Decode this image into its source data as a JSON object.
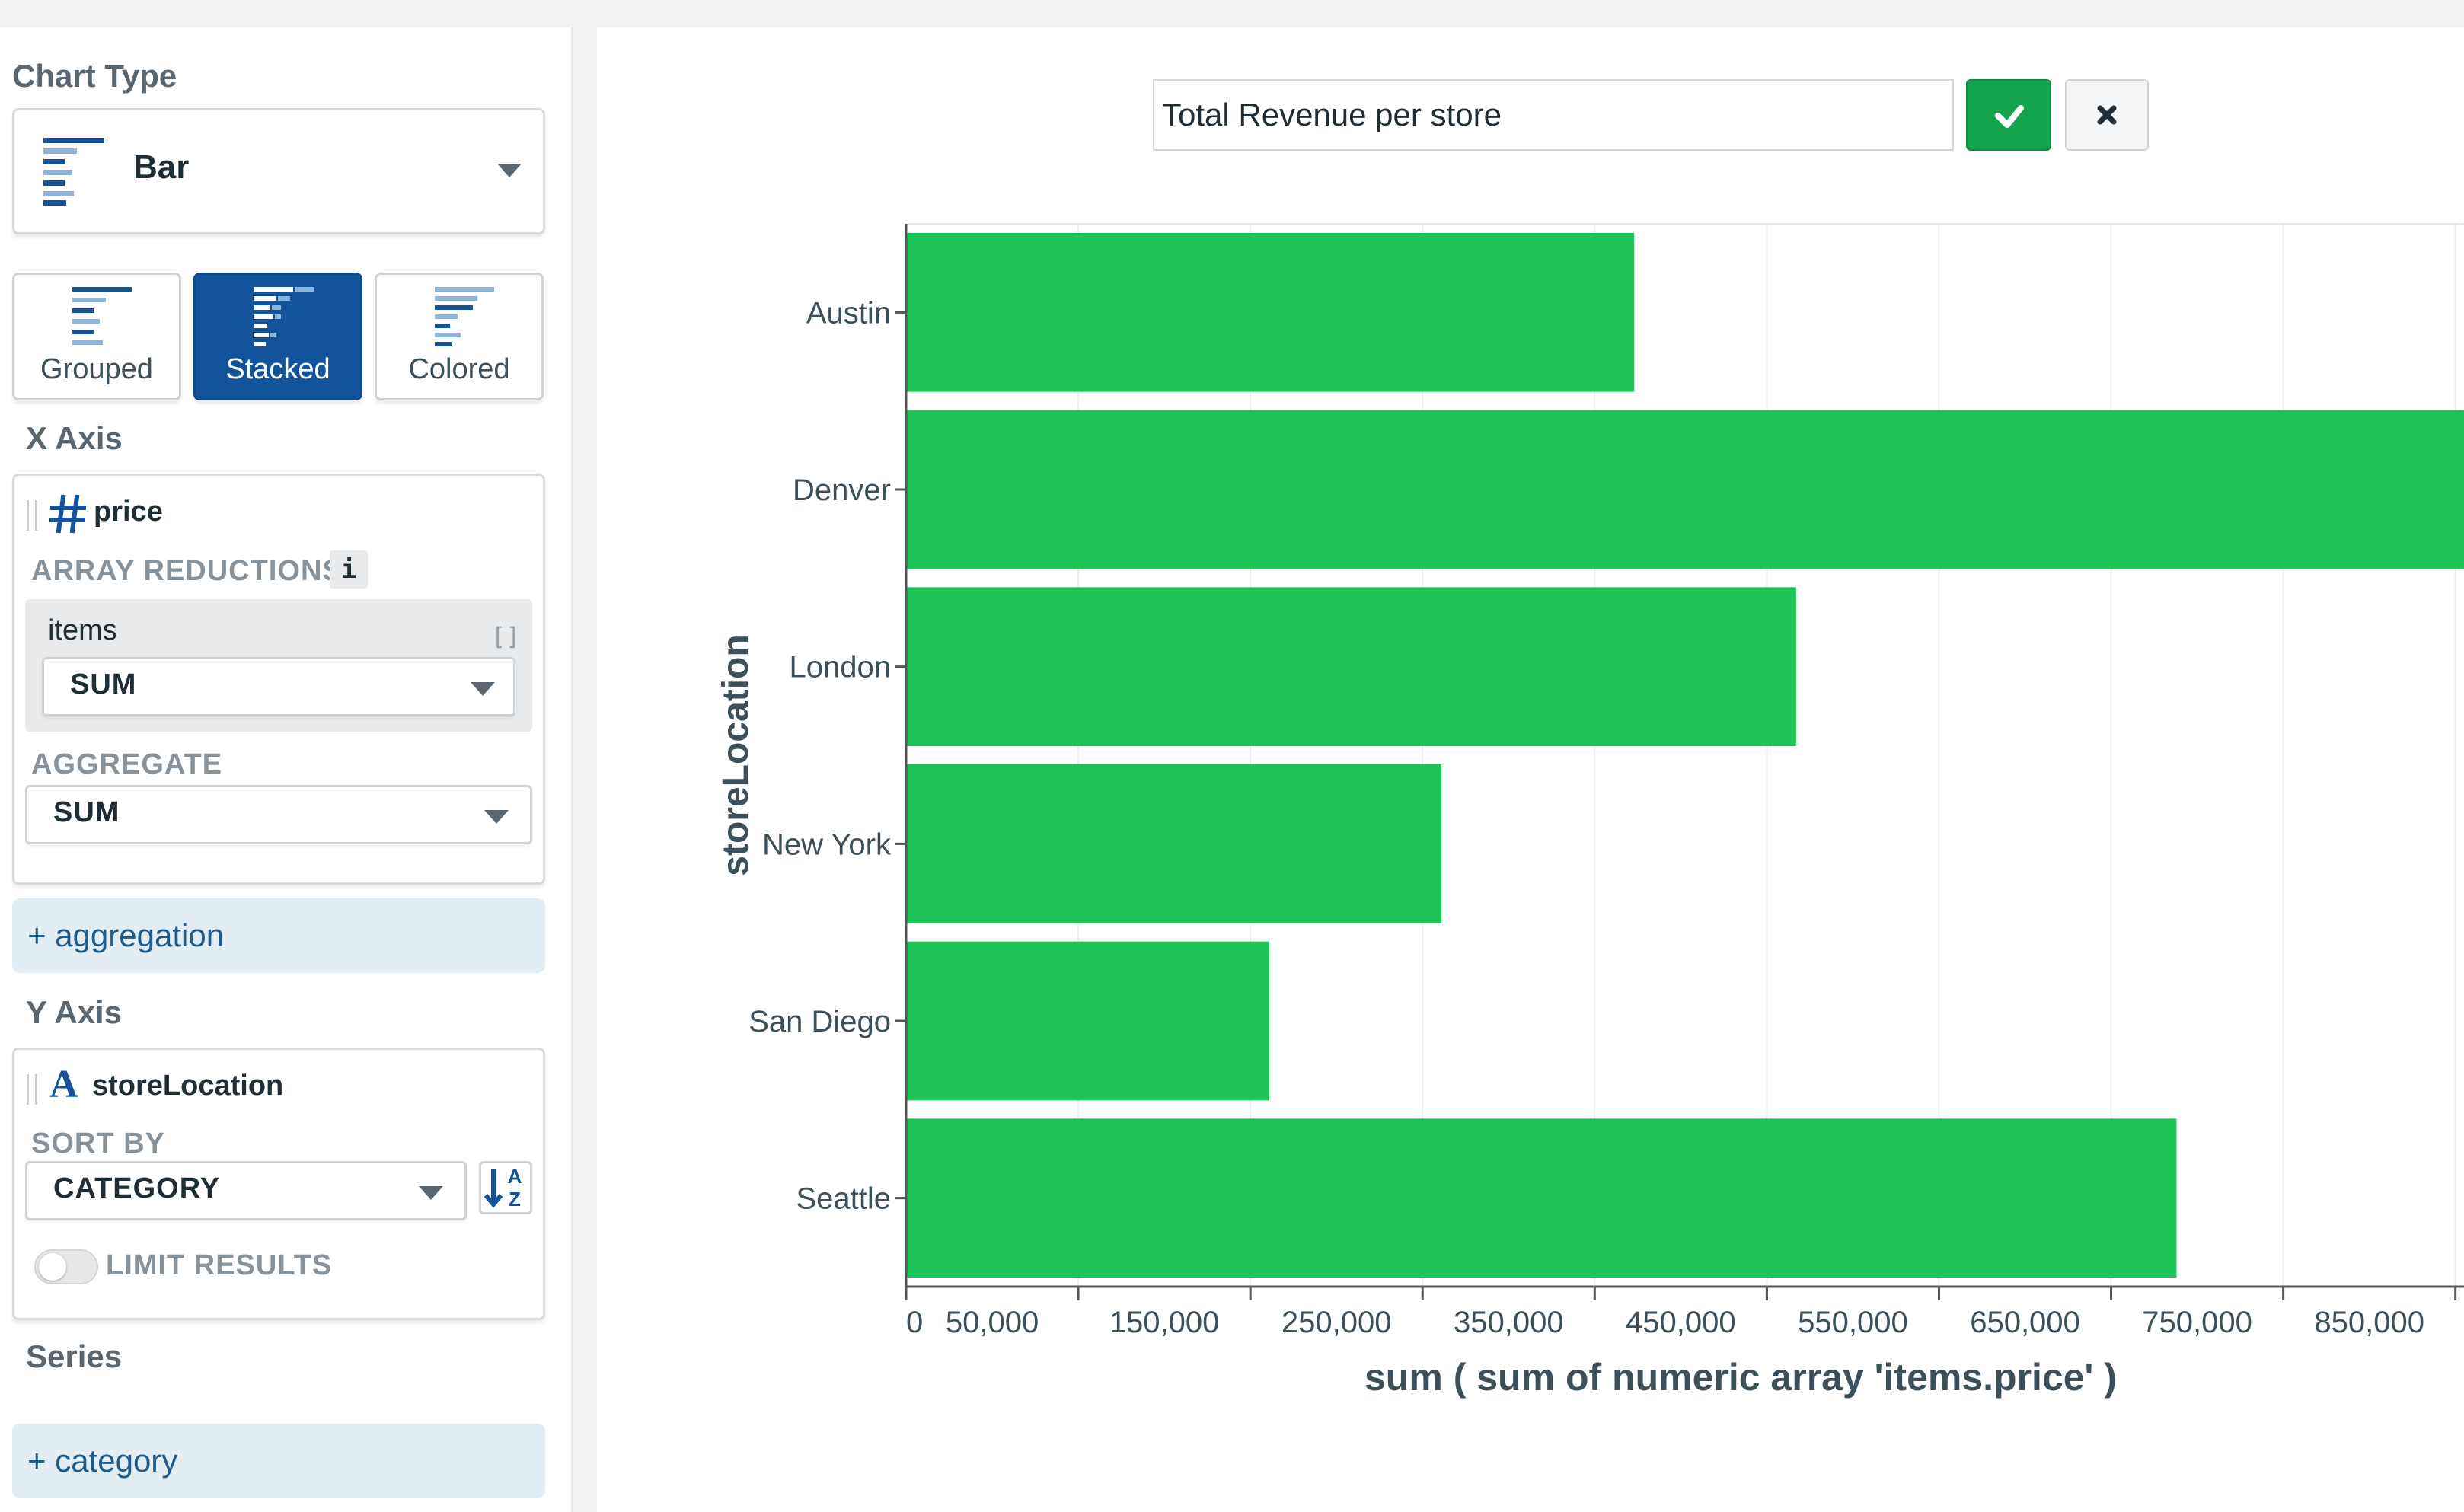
{
  "sidebar": {
    "chart_type": {
      "title": "Chart Type",
      "selected": "Bar",
      "subtypes": [
        {
          "label": "Grouped",
          "active": false
        },
        {
          "label": "Stacked",
          "active": true
        },
        {
          "label": "Colored",
          "active": false
        }
      ]
    },
    "x_axis": {
      "title": "X Axis",
      "field": "price",
      "field_type_icon": "number-hash-icon",
      "array_reductions_label": "ARRAY REDUCTIONS",
      "info_glyph": "i",
      "reduction_field": "items",
      "reduction_value": "SUM",
      "aggregate_label": "AGGREGATE",
      "aggregate_value": "SUM",
      "add_label": "+ aggregation"
    },
    "y_axis": {
      "title": "Y Axis",
      "field": "storeLocation",
      "field_type_icon": "text-type-icon",
      "sort_by_label": "SORT BY",
      "sort_value": "CATEGORY",
      "sort_glyph_top": "A",
      "sort_glyph_bottom": "Z",
      "limit_label": "LIMIT RESULTS",
      "limit_enabled": false
    },
    "series": {
      "title": "Series",
      "add_label": "+ category"
    }
  },
  "main": {
    "chart_title_value": "Total Revenue per store"
  },
  "colors": {
    "bar": "#1dc457",
    "accent_blue": "#13539c",
    "confirm_green": "#14a44d"
  },
  "chart_data": {
    "type": "bar",
    "orientation": "horizontal",
    "categories": [
      "Austin",
      "Denver",
      "London",
      "New York",
      "San Diego",
      "Seattle"
    ],
    "values": [
      423000,
      905000,
      517000,
      311000,
      211000,
      738000
    ],
    "xlabel": "sum ( sum of numeric array 'items.price' )",
    "ylabel": "storeLocation",
    "xticks": [
      0,
      50000,
      150000,
      250000,
      350000,
      450000,
      550000,
      650000,
      750000,
      850000
    ],
    "xtick_labels": [
      "0",
      "50,000",
      "150,000",
      "250,000",
      "350,000",
      "450,000",
      "550,000",
      "650,000",
      "750,000",
      "850,000"
    ],
    "xlim": [
      0,
      905000
    ],
    "grid": true
  }
}
